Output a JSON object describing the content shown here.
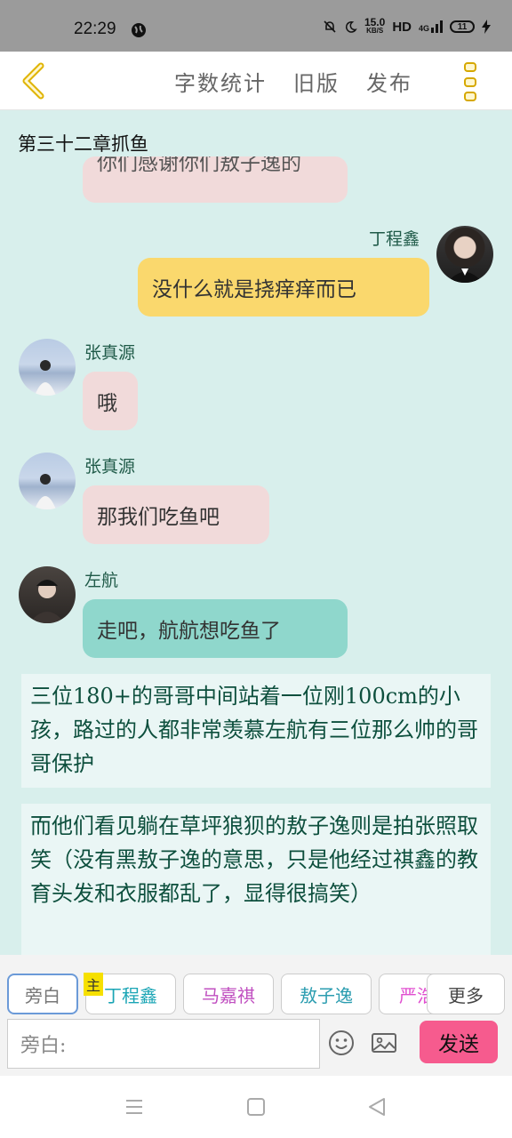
{
  "status_bar": {
    "time": "22:29",
    "net_speed": "15.0",
    "net_unit": "KB/S",
    "hd": "HD",
    "signal": "4G",
    "battery": "11"
  },
  "header": {
    "menu": [
      "字数统计",
      "旧版",
      "发布"
    ]
  },
  "chapter_title": "第三十二章抓鱼",
  "messages": [
    {
      "speaker": "",
      "text": "你们感谢你们敖子逸的"
    },
    {
      "speaker": "丁程鑫",
      "text": "没什么就是挠痒痒而已"
    },
    {
      "speaker": "张真源",
      "text": "哦"
    },
    {
      "speaker": "张真源",
      "text": "那我们吃鱼吧"
    },
    {
      "speaker": "左航",
      "text": "走吧，航航想吃鱼了"
    }
  ],
  "narrations": [
    "三位180+的哥哥中间站着一位刚100cm的小孩，路过的人都非常羡慕左航有三位那么帅的哥哥保护",
    "而他们看见躺在草坪狼狈的敖子逸则是拍张照取笑（没有黑敖子逸的意思，只是他经过祺鑫的教育头发和衣服都乱了，显得很搞笑）"
  ],
  "composer": {
    "roles": [
      {
        "label": "旁白",
        "color": "#777777"
      },
      {
        "label": "丁程鑫",
        "color": "#1aa5b5"
      },
      {
        "label": "马嘉祺",
        "color": "#c04fc0"
      },
      {
        "label": "敖子逸",
        "color": "#2b9db0"
      },
      {
        "label": "严浩",
        "color": "#e04fd0"
      }
    ],
    "main_badge": "主",
    "more": "更多",
    "placeholder": "旁白:",
    "send": "发送"
  }
}
